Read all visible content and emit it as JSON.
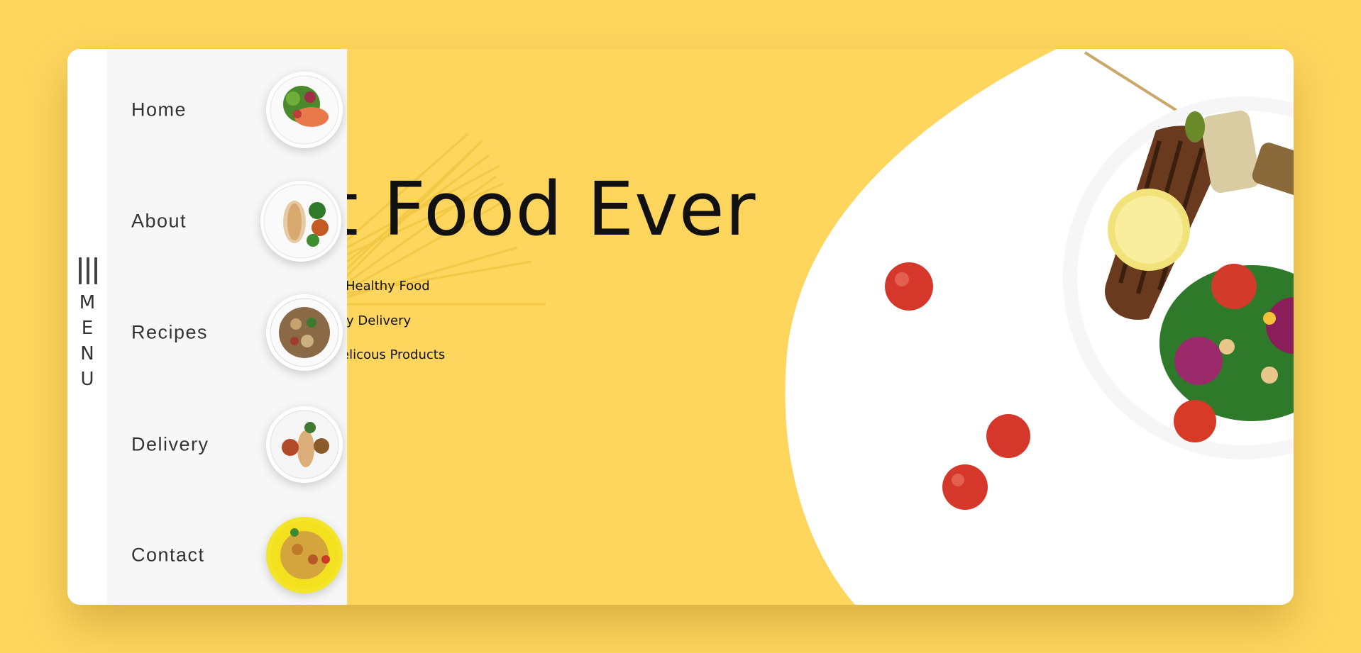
{
  "menu": {
    "toggle_icon": "hamburger-icon",
    "letters": [
      "M",
      "E",
      "N",
      "U"
    ]
  },
  "nav": {
    "items": [
      {
        "label": "Home",
        "thumb": "salmon-salad-plate"
      },
      {
        "label": "About",
        "thumb": "grilled-chicken-plate"
      },
      {
        "label": "Recipes",
        "thumb": "noodle-salad-plate"
      },
      {
        "label": "Delivery",
        "thumb": "chicken-vegetable-plate"
      },
      {
        "label": "Contact",
        "thumb": "rice-dish-plate"
      }
    ]
  },
  "hero": {
    "title": "st Food Ever",
    "features": [
      "Healthy Food",
      "ay Delivery",
      "elicous Products"
    ]
  },
  "colors": {
    "background": "#fed65e",
    "card": "#ffffff",
    "nav_panel": "#f7f7f7",
    "text": "#111111"
  }
}
